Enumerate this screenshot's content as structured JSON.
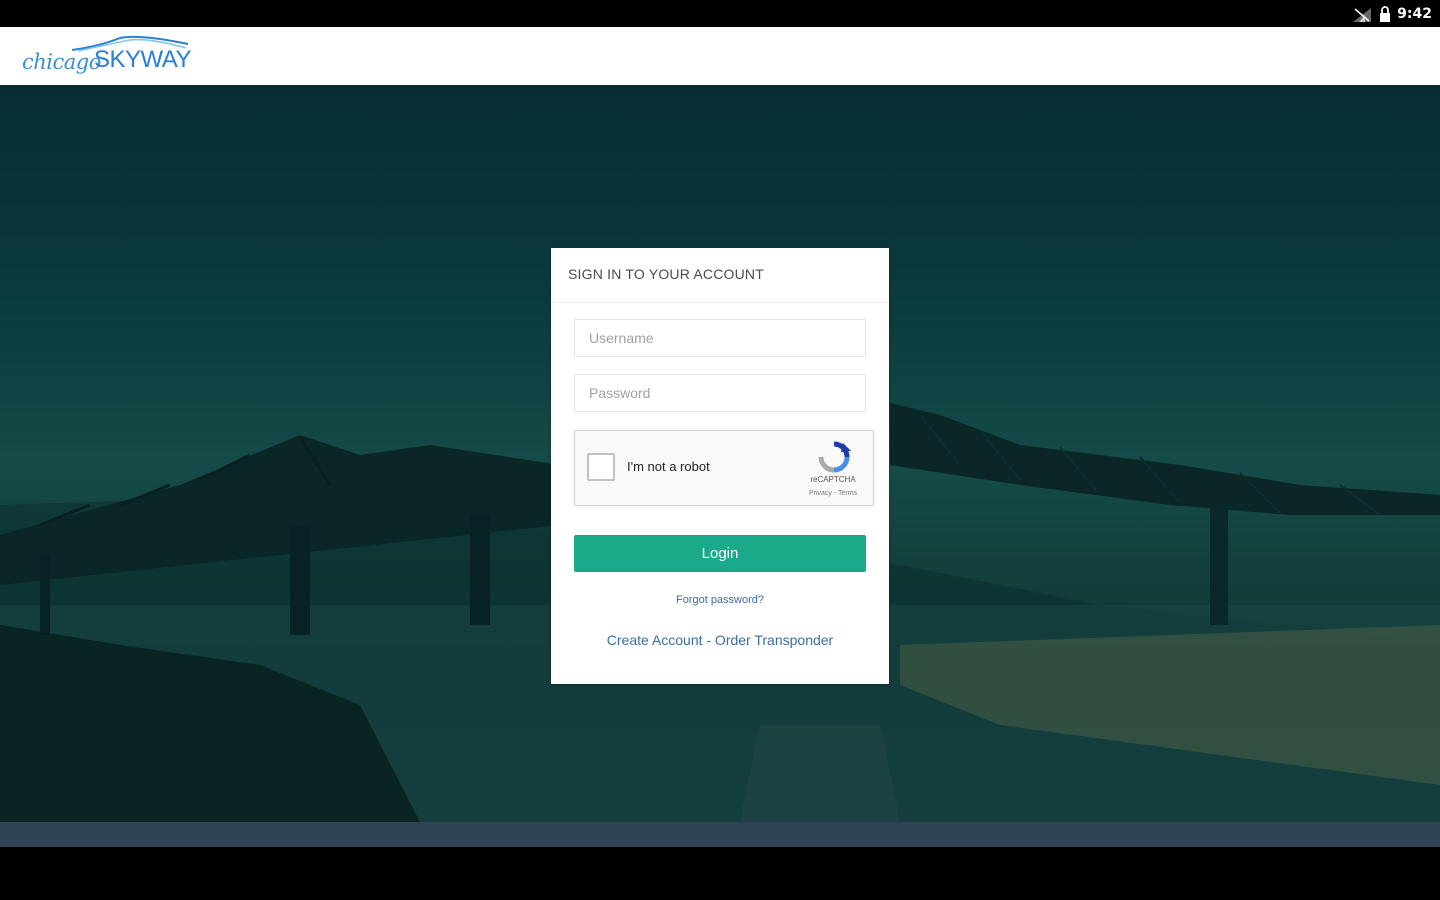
{
  "status_bar": {
    "time": "9:42"
  },
  "header": {
    "logo_text_chicago": "chicago",
    "logo_text_skyway": "SKYWAY"
  },
  "login": {
    "title": "SIGN IN TO YOUR ACCOUNT",
    "username_placeholder": "Username",
    "password_placeholder": "Password",
    "recaptcha": {
      "label": "I'm not a robot",
      "brand": "reCAPTCHA",
      "terms": "Privacy - Terms"
    },
    "login_button": "Login",
    "forgot_password": "Forgot password?",
    "create_account": "Create Account - Order Transponder"
  },
  "colors": {
    "brand_blue": "#2a7fd2",
    "button_green": "#1aaa8a",
    "link_blue": "#3a6ea5",
    "hero_overlay": "#0a3b3e"
  },
  "icons": [
    "signal-icon",
    "lock-icon",
    "recaptcha-logo-icon",
    "bridge-logo-icon"
  ]
}
